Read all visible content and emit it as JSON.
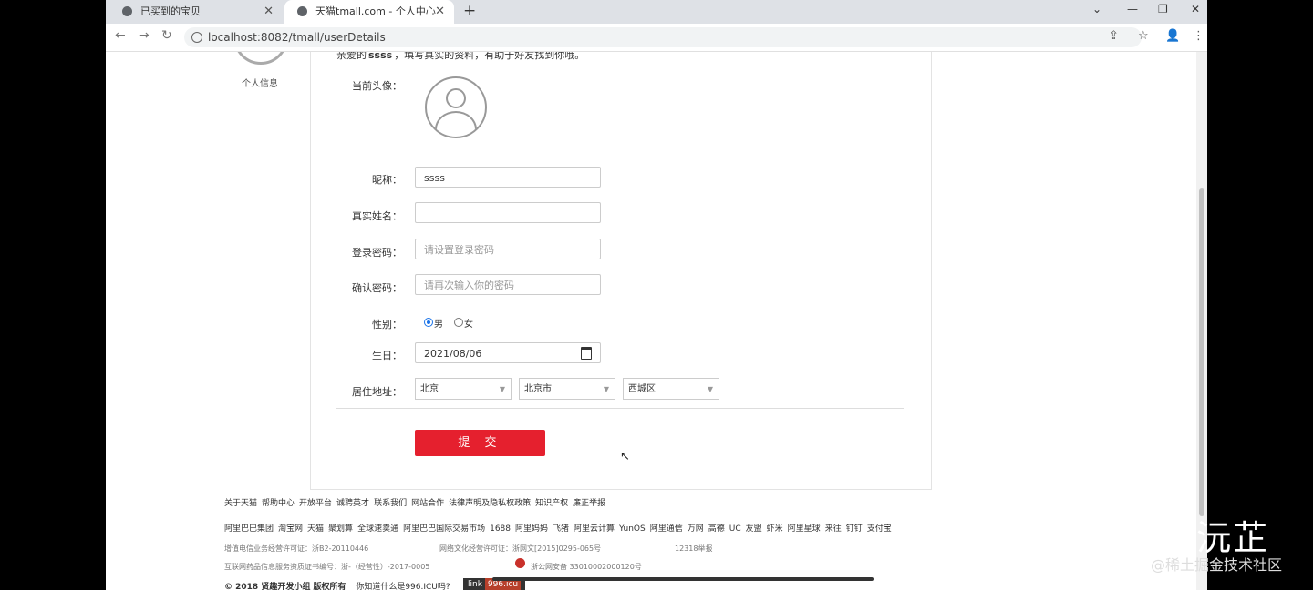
{
  "browser": {
    "tabs": [
      {
        "label": "已买到的宝贝",
        "close": "✕"
      },
      {
        "label": "天猫tmall.com - 个人中心",
        "close": "✕"
      }
    ],
    "new_tab": "+",
    "window_controls": [
      "⌄",
      "—",
      "❐",
      "✕"
    ],
    "nav": {
      "back": "←",
      "forward": "→",
      "reload": "↻"
    },
    "url": "localhost:8082/tmall/userDetails",
    "toolbar_icons": [
      "⇪",
      "☆",
      "👤",
      "⋮"
    ]
  },
  "sidebar": {
    "label": "个人信息"
  },
  "form": {
    "greeting_prefix": "亲爱的",
    "username": "ssss",
    "greeting_suffix": "，填写真实的资料，有助于好友找到你哦。",
    "avatar_label": "当前头像：",
    "nickname_label": "昵称：",
    "nickname_value": "ssss",
    "realname_label": "真实姓名：",
    "realname_value": "",
    "password_label": "登录密码：",
    "password_placeholder": "请设置登录密码",
    "confirm_label": "确认密码：",
    "confirm_placeholder": "请再次输入你的密码",
    "gender_label": "性别：",
    "gender_male": "男",
    "gender_female": "女",
    "gender_selected": "男",
    "birthday_label": "生日：",
    "birthday_value": "2021/08/06",
    "address_label": "居住地址：",
    "province": "北京",
    "city": "北京市",
    "district": "西城区",
    "submit": "提 交"
  },
  "footer": {
    "links": [
      "关于天猫",
      "帮助中心",
      "开放平台",
      "诚聘英才",
      "联系我们",
      "网站合作",
      "法律声明及隐私权政策",
      "知识产权",
      "廉正举报"
    ],
    "partners": [
      "阿里巴巴集团",
      "淘宝网",
      "天猫",
      "聚划算",
      "全球速卖通",
      "阿里巴巴国际交易市场",
      "1688",
      "阿里妈妈",
      "飞猪",
      "阿里云计算",
      "YunOS",
      "阿里通信",
      "万网",
      "高德",
      "UC",
      "友盟",
      "虾米",
      "阿里星球",
      "来往",
      "钉钉",
      "支付宝"
    ],
    "license1": "增值电信业务经营许可证：浙B2-20110446",
    "license2": "网络文化经营许可证：浙网文[2015]0295-065号",
    "license3": "12318举报",
    "license4": "互联网药品信息服务资质证书编号：浙-（经营性）-2017-0005",
    "license5": "浙公网安备 33010002000120号",
    "copyright_bold": "© 2018 贤趣开发小组 版权所有",
    "copyright_question": "你知道什么是996.ICU吗?",
    "tip_link_label": "link",
    "tip_link_value": "996.icu"
  },
  "watermark": {
    "main": "知乎 @小沅芷",
    "sub": "@稀土掘金技术社区"
  }
}
